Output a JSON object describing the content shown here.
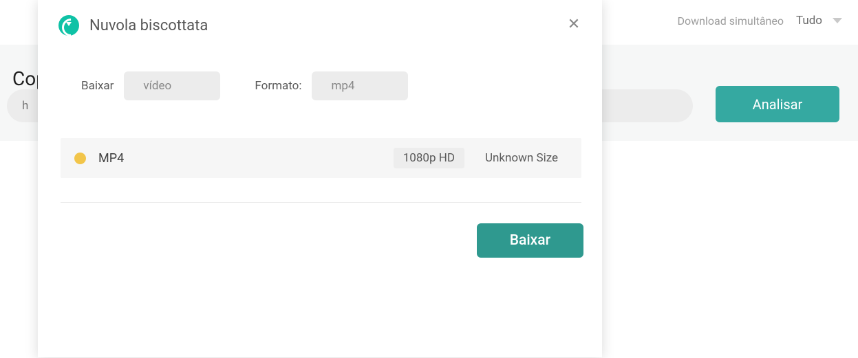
{
  "header": {
    "simultaneous_label": "Download simultâneo",
    "dropdown_value": "Tudo"
  },
  "background": {
    "title_truncated": "Cop",
    "url_truncated": "h",
    "analyze_label": "Analisar"
  },
  "modal": {
    "title": "Nuvola biscottata",
    "filter": {
      "download_label": "Baixar",
      "download_value": "vídeo",
      "format_label": "Formato:",
      "format_value": "mp4"
    },
    "formats": [
      {
        "name": "MP4",
        "quality": "1080p HD",
        "size": "Unknown Size"
      }
    ],
    "download_button": "Baixar"
  }
}
